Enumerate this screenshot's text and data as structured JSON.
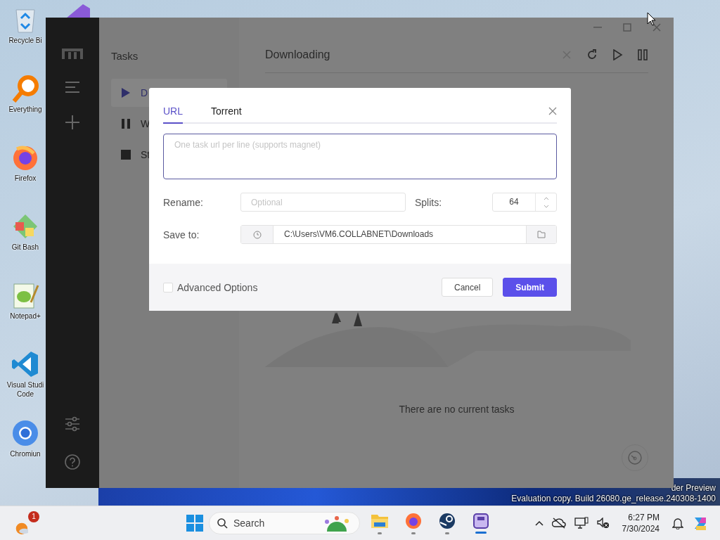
{
  "desktop": {
    "icons": [
      {
        "kind": "recycle",
        "label": "Recycle Bi"
      },
      {
        "kind": "everything",
        "label": "Everything"
      },
      {
        "kind": "firefox",
        "label": "Firefox"
      },
      {
        "kind": "git",
        "label": "Git Bash"
      },
      {
        "kind": "notepad",
        "label": "Notepad+"
      },
      {
        "kind": "vscode",
        "label": "Visual Studi\nCode"
      },
      {
        "kind": "chromium",
        "label": "Chromiun"
      }
    ],
    "watermark": [
      "der Preview",
      "Evaluation copy. Build 26080.ge_release.240308-1400"
    ]
  },
  "window": {
    "tasks": {
      "title": "Tasks",
      "items": [
        {
          "kind": "play",
          "label": "D",
          "selected": true
        },
        {
          "kind": "pause",
          "label": "W",
          "selected": false
        },
        {
          "kind": "stop",
          "label": "St",
          "selected": false
        }
      ]
    },
    "main": {
      "title": "Downloading",
      "empty_text": "There are no current tasks"
    }
  },
  "dialog": {
    "tabs": [
      {
        "label": "URL",
        "selected": true
      },
      {
        "label": "Torrent",
        "selected": false
      }
    ],
    "url_field": {
      "placeholder": "One task url per line (supports magnet)"
    },
    "rename": {
      "label": "Rename:",
      "placeholder": "Optional"
    },
    "splits": {
      "label": "Splits:",
      "value": "64"
    },
    "save_to": {
      "label": "Save to:",
      "value": "C:\\Users\\VM6.COLLABNET\\Downloads"
    },
    "advanced_options": {
      "label": "Advanced Options",
      "checked": false
    },
    "buttons": [
      {
        "kind": "secondary",
        "label": "Cancel"
      },
      {
        "kind": "primary",
        "label": "Submit"
      }
    ]
  },
  "taskbar": {
    "weather_badge": "1",
    "search": {
      "placeholder": "Search"
    },
    "apps": [
      {
        "kind": "explorer",
        "active": false
      },
      {
        "kind": "firefox",
        "active": false
      },
      {
        "kind": "steam",
        "active": false
      },
      {
        "kind": "app",
        "active": true
      }
    ],
    "time": "6:27 PM",
    "date": "7/30/2024"
  }
}
